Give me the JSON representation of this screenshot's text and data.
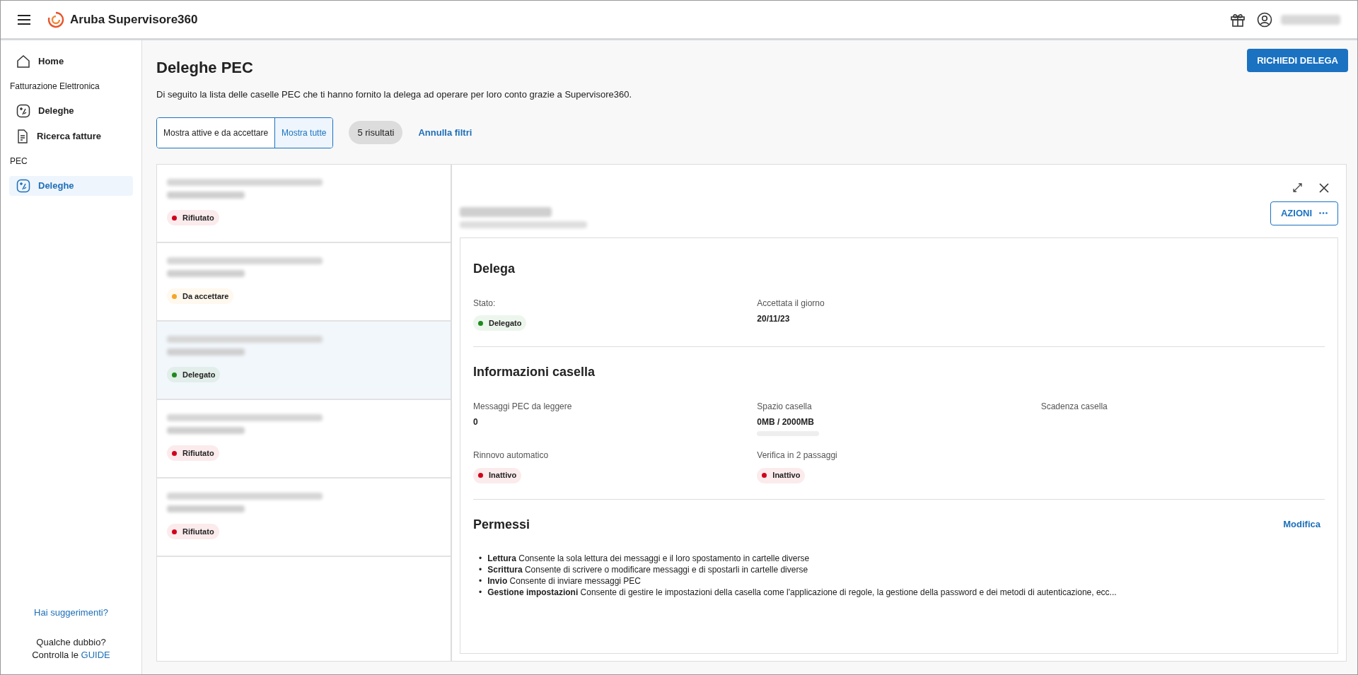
{
  "header": {
    "app_name": "Aruba Supervisore360"
  },
  "sidebar": {
    "items": [
      {
        "kind": "home",
        "label": "Home",
        "selected": false
      },
      {
        "kind": "section",
        "label": "Fatturazione Elettronica"
      },
      {
        "kind": "delega",
        "label": "Deleghe",
        "selected": false
      },
      {
        "kind": "fatture",
        "label": "Ricerca fatture",
        "selected": false
      },
      {
        "kind": "section",
        "label": "PEC"
      },
      {
        "kind": "delega",
        "label": "Deleghe",
        "selected": true
      }
    ],
    "suggestions_link": "Hai suggerimenti?",
    "help_text": "Qualche dubbio? Controlla le",
    "help_link": "GUIDE"
  },
  "page": {
    "title": "Deleghe PEC",
    "description": "Di seguito la lista delle caselle PEC che ti hanno fornito la delega ad operare per loro conto grazie a Supervisore360.",
    "request_button": "RICHIEDI DELEGA",
    "filters": [
      {
        "label": "Mostra attive e da accettare",
        "selected": false
      },
      {
        "label": "Mostra tutte",
        "selected": true
      }
    ],
    "results": "5 risultati",
    "clear_filters": "Annulla filtri"
  },
  "list": {
    "items": [
      {
        "status": "Rifiutato",
        "color": "#d0021b",
        "selected": false
      },
      {
        "status": "Da accettare",
        "color": "#f5a623",
        "selected": false
      },
      {
        "status": "Delegato",
        "color": "#1e8a1e",
        "selected": true
      },
      {
        "status": "Rifiutato",
        "color": "#d0021b",
        "selected": false
      },
      {
        "status": "Rifiutato",
        "color": "#d0021b",
        "selected": false
      }
    ]
  },
  "detail": {
    "actions_button": "AZIONI",
    "sections": [
      {
        "title": "Delega",
        "fields": [
          {
            "kind": "badge",
            "label": "Stato:",
            "value": "Delegato",
            "color": "#1e8a1e"
          },
          {
            "kind": "text",
            "label": "Accettata il giorno",
            "value": "20/11/23"
          }
        ]
      },
      {
        "title": "Informazioni casella",
        "fields": [
          {
            "kind": "text",
            "label": "Messaggi PEC da leggere",
            "value": "0"
          },
          {
            "kind": "meter",
            "label": "Spazio casella",
            "value": "0MB / 2000MB",
            "level": 0
          },
          {
            "kind": "empty",
            "label": "Scadenza casella"
          },
          {
            "kind": "badge",
            "label": "Rinnovo automatico",
            "value": "Inattivo",
            "color": "#d0021b"
          },
          {
            "kind": "badge",
            "label": "Verifica in 2 passaggi",
            "value": "Inattivo",
            "color": "#d0021b"
          }
        ]
      }
    ],
    "permissions": {
      "title": "Permessi",
      "edit_link": "Modifica",
      "items": [
        {
          "marker": "•",
          "text": "**Lettura** Consente la sola lettura dei messaggi e il loro spostamento in cartelle diverse"
        },
        {
          "marker": "•",
          "text": "**Scrittura** Consente di scrivere o modificare messaggi e di spostarli in cartelle diverse"
        },
        {
          "marker": "•",
          "text": "**Invio** Consente di inviare messaggi PEC"
        },
        {
          "marker": "•",
          "text": "**Gestione impostazioni** Consente di gestire le impostazioni della casella come l'applicazione di regole, la gestione della password e dei metodi di autenticazione, ecc..."
        }
      ]
    }
  }
}
